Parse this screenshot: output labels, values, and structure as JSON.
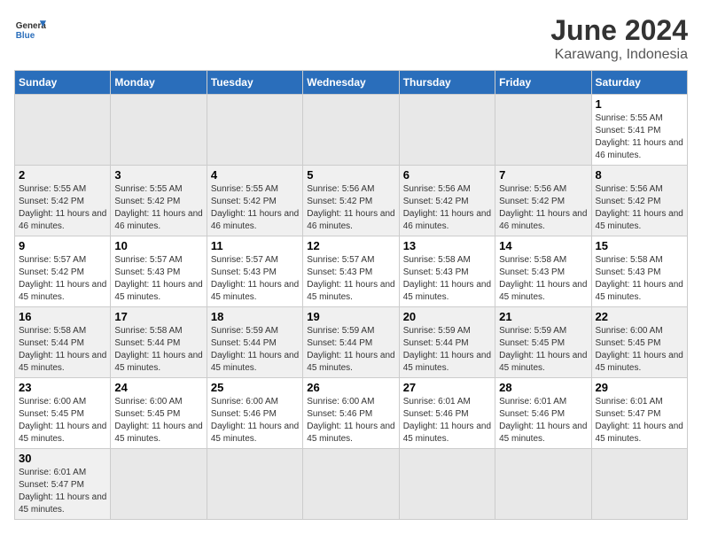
{
  "header": {
    "logo_general": "General",
    "logo_blue": "Blue",
    "title": "June 2024",
    "subtitle": "Karawang, Indonesia"
  },
  "weekdays": [
    "Sunday",
    "Monday",
    "Tuesday",
    "Wednesday",
    "Thursday",
    "Friday",
    "Saturday"
  ],
  "weeks": [
    [
      {
        "day": null
      },
      {
        "day": null
      },
      {
        "day": null
      },
      {
        "day": null
      },
      {
        "day": null
      },
      {
        "day": null
      },
      {
        "day": 1,
        "sunrise": "5:55 AM",
        "sunset": "5:41 PM",
        "daylight": "11 hours and 46 minutes."
      }
    ],
    [
      {
        "day": 2,
        "sunrise": "5:55 AM",
        "sunset": "5:42 PM",
        "daylight": "11 hours and 46 minutes."
      },
      {
        "day": 3,
        "sunrise": "5:55 AM",
        "sunset": "5:42 PM",
        "daylight": "11 hours and 46 minutes."
      },
      {
        "day": 4,
        "sunrise": "5:55 AM",
        "sunset": "5:42 PM",
        "daylight": "11 hours and 46 minutes."
      },
      {
        "day": 5,
        "sunrise": "5:56 AM",
        "sunset": "5:42 PM",
        "daylight": "11 hours and 46 minutes."
      },
      {
        "day": 6,
        "sunrise": "5:56 AM",
        "sunset": "5:42 PM",
        "daylight": "11 hours and 46 minutes."
      },
      {
        "day": 7,
        "sunrise": "5:56 AM",
        "sunset": "5:42 PM",
        "daylight": "11 hours and 46 minutes."
      },
      {
        "day": 8,
        "sunrise": "5:56 AM",
        "sunset": "5:42 PM",
        "daylight": "11 hours and 45 minutes."
      }
    ],
    [
      {
        "day": 9,
        "sunrise": "5:57 AM",
        "sunset": "5:42 PM",
        "daylight": "11 hours and 45 minutes."
      },
      {
        "day": 10,
        "sunrise": "5:57 AM",
        "sunset": "5:43 PM",
        "daylight": "11 hours and 45 minutes."
      },
      {
        "day": 11,
        "sunrise": "5:57 AM",
        "sunset": "5:43 PM",
        "daylight": "11 hours and 45 minutes."
      },
      {
        "day": 12,
        "sunrise": "5:57 AM",
        "sunset": "5:43 PM",
        "daylight": "11 hours and 45 minutes."
      },
      {
        "day": 13,
        "sunrise": "5:58 AM",
        "sunset": "5:43 PM",
        "daylight": "11 hours and 45 minutes."
      },
      {
        "day": 14,
        "sunrise": "5:58 AM",
        "sunset": "5:43 PM",
        "daylight": "11 hours and 45 minutes."
      },
      {
        "day": 15,
        "sunrise": "5:58 AM",
        "sunset": "5:43 PM",
        "daylight": "11 hours and 45 minutes."
      }
    ],
    [
      {
        "day": 16,
        "sunrise": "5:58 AM",
        "sunset": "5:44 PM",
        "daylight": "11 hours and 45 minutes."
      },
      {
        "day": 17,
        "sunrise": "5:58 AM",
        "sunset": "5:44 PM",
        "daylight": "11 hours and 45 minutes."
      },
      {
        "day": 18,
        "sunrise": "5:59 AM",
        "sunset": "5:44 PM",
        "daylight": "11 hours and 45 minutes."
      },
      {
        "day": 19,
        "sunrise": "5:59 AM",
        "sunset": "5:44 PM",
        "daylight": "11 hours and 45 minutes."
      },
      {
        "day": 20,
        "sunrise": "5:59 AM",
        "sunset": "5:44 PM",
        "daylight": "11 hours and 45 minutes."
      },
      {
        "day": 21,
        "sunrise": "5:59 AM",
        "sunset": "5:45 PM",
        "daylight": "11 hours and 45 minutes."
      },
      {
        "day": 22,
        "sunrise": "6:00 AM",
        "sunset": "5:45 PM",
        "daylight": "11 hours and 45 minutes."
      }
    ],
    [
      {
        "day": 23,
        "sunrise": "6:00 AM",
        "sunset": "5:45 PM",
        "daylight": "11 hours and 45 minutes."
      },
      {
        "day": 24,
        "sunrise": "6:00 AM",
        "sunset": "5:45 PM",
        "daylight": "11 hours and 45 minutes."
      },
      {
        "day": 25,
        "sunrise": "6:00 AM",
        "sunset": "5:46 PM",
        "daylight": "11 hours and 45 minutes."
      },
      {
        "day": 26,
        "sunrise": "6:00 AM",
        "sunset": "5:46 PM",
        "daylight": "11 hours and 45 minutes."
      },
      {
        "day": 27,
        "sunrise": "6:01 AM",
        "sunset": "5:46 PM",
        "daylight": "11 hours and 45 minutes."
      },
      {
        "day": 28,
        "sunrise": "6:01 AM",
        "sunset": "5:46 PM",
        "daylight": "11 hours and 45 minutes."
      },
      {
        "day": 29,
        "sunrise": "6:01 AM",
        "sunset": "5:47 PM",
        "daylight": "11 hours and 45 minutes."
      }
    ],
    [
      {
        "day": 30,
        "sunrise": "6:01 AM",
        "sunset": "5:47 PM",
        "daylight": "11 hours and 45 minutes."
      },
      {
        "day": null
      },
      {
        "day": null
      },
      {
        "day": null
      },
      {
        "day": null
      },
      {
        "day": null
      },
      {
        "day": null
      }
    ]
  ],
  "labels": {
    "sunrise_prefix": "Sunrise: ",
    "sunset_prefix": "Sunset: ",
    "daylight_prefix": "Daylight: "
  }
}
